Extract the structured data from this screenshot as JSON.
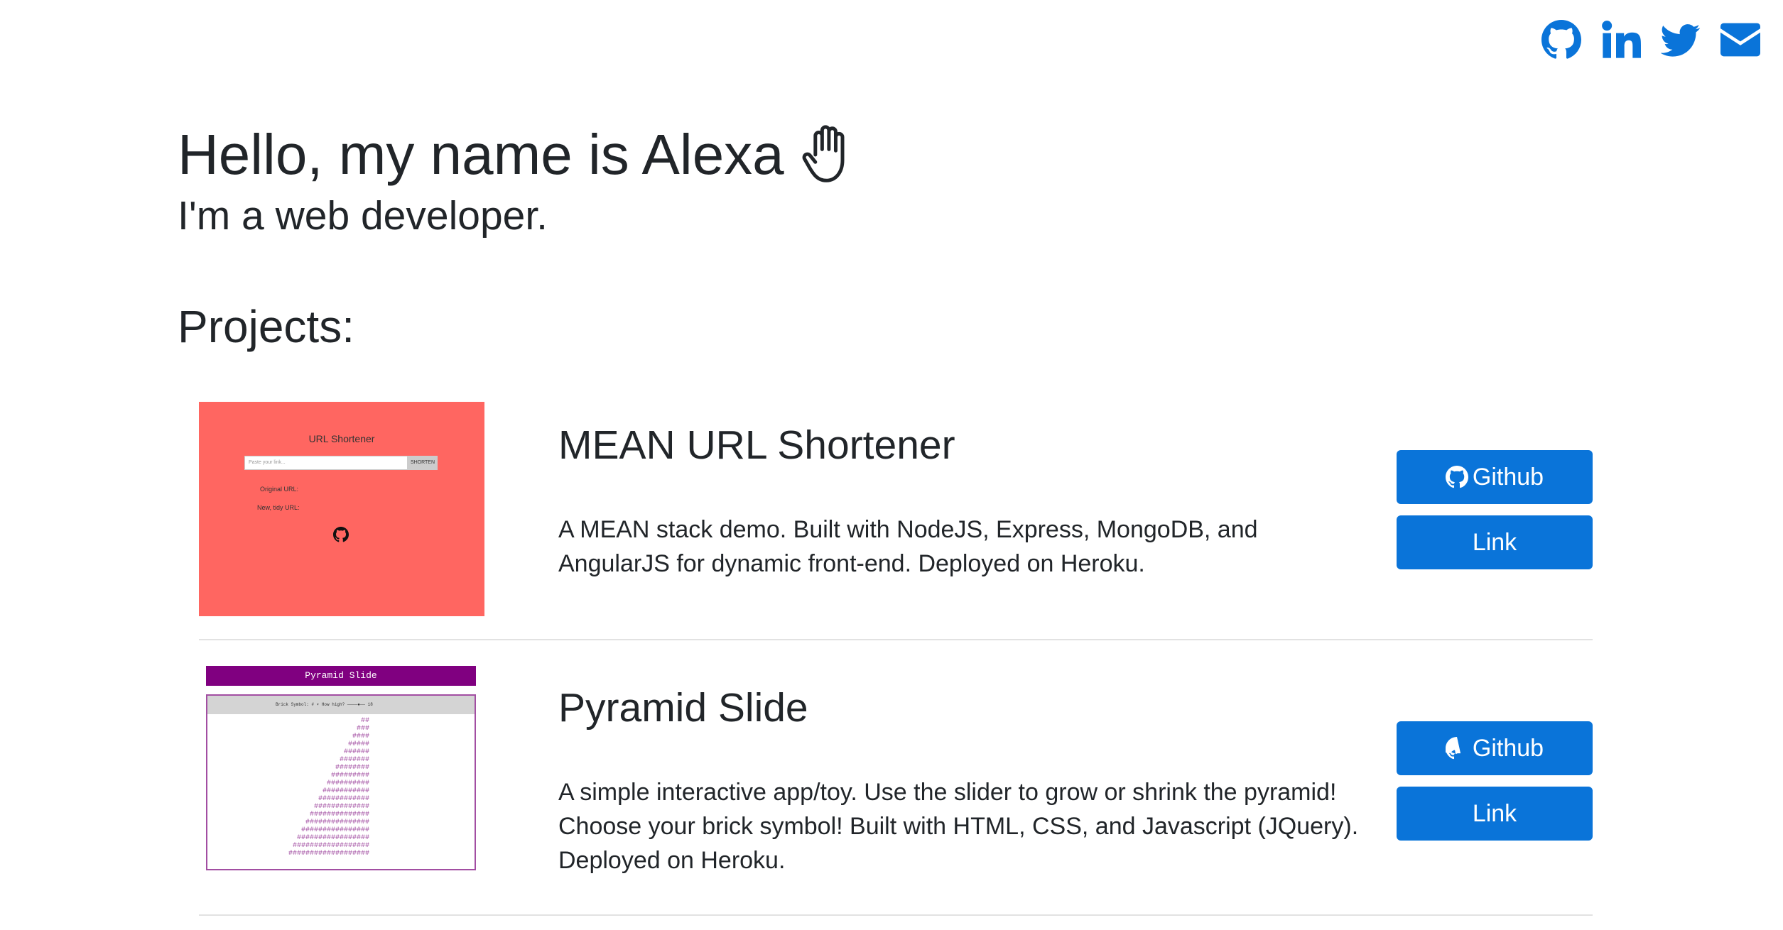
{
  "social": {
    "items": [
      {
        "name": "github-icon",
        "icon": "github"
      },
      {
        "name": "linkedin-icon",
        "icon": "linkedin"
      },
      {
        "name": "twitter-icon",
        "icon": "twitter"
      },
      {
        "name": "email-icon",
        "icon": "envelope"
      }
    ],
    "accent_color": "#0a74d9"
  },
  "hero": {
    "title": "Hello, my name is Alexa",
    "subtitle": "I'm a web developer.",
    "emoji_icon": "raised-hand"
  },
  "projects_heading": "Projects:",
  "projects": [
    {
      "title": "MEAN URL Shortener",
      "description": "A MEAN stack demo. Built with NodeJS, Express, MongoDB, and AngularJS for dynamic front-end. Deployed on Heroku.",
      "buttons": {
        "github": "Github",
        "link": "Link"
      },
      "thumbnail": {
        "title": "URL Shortener",
        "input_placeholder": "Paste your link...",
        "button": "SHORTEN",
        "original_label": "Original URL:",
        "new_label": "New, tidy URL:",
        "background": "#ff6661"
      }
    },
    {
      "title": "Pyramid Slide",
      "description": "A simple interactive app/toy. Use the slider to grow or shrink the pyramid! Choose your brick symbol! Built with HTML, CSS, and Javascript (JQuery). Deployed on Heroku.",
      "buttons": {
        "github": "Github",
        "link": "Link"
      },
      "thumbnail": {
        "title": "Pyramid Slide",
        "controls": "Brick Symbol: # ▾     How high?  ────●──   18",
        "brick": "#",
        "rows": 18,
        "color": "#800080"
      }
    }
  ]
}
